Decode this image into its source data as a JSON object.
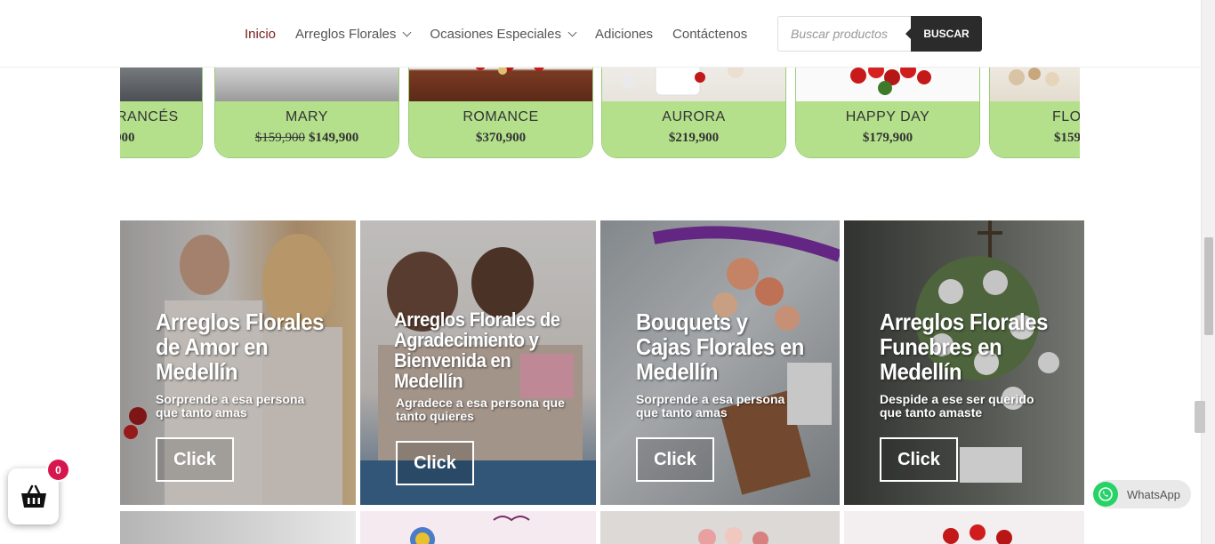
{
  "nav": {
    "items": [
      {
        "label": "Inicio",
        "dropdown": false,
        "active": true
      },
      {
        "label": "Arreglos Florales",
        "dropdown": true
      },
      {
        "label": "Ocasiones Especiales",
        "dropdown": true
      },
      {
        "label": "Adiciones",
        "dropdown": false
      },
      {
        "label": "Contáctenos",
        "dropdown": false
      }
    ],
    "search_placeholder": "Buscar productos",
    "search_button": "BUSCAR"
  },
  "products": [
    {
      "name": "RANCÉS",
      "price": "900"
    },
    {
      "name": "MARY",
      "old_price": "$159,900",
      "price": "$149,900"
    },
    {
      "name": "ROMANCE",
      "price": "$370,900"
    },
    {
      "name": "AURORA",
      "price": "$219,900"
    },
    {
      "name": "HAPPY DAY",
      "price": "$179,900"
    },
    {
      "name": "FLORERO",
      "price": "$159"
    }
  ],
  "categories": [
    {
      "title": "Arreglos Florales de Amor en Medellín",
      "subtitle": "Sorprende a esa persona que tanto amas",
      "button": "Click"
    },
    {
      "title": "Arreglos Florales de Agradecimiento y Bienvenida en Medellín",
      "subtitle": "Agradece a esa persona que tanto quieres",
      "button": "Click"
    },
    {
      "title": "Bouquets y Cajas Florales en Medellín",
      "subtitle": "Sorprende a esa persona que tanto amas",
      "button": "Click"
    },
    {
      "title": "Arreglos Florales Funebres en Medellín",
      "subtitle": "Despide a ese ser querido que tanto amaste",
      "button": "Click"
    }
  ],
  "cart": {
    "count": "0"
  },
  "whatsapp": {
    "label": "WhatsApp"
  },
  "colors": {
    "accent": "#7a2020",
    "product_card": "#b4e08c",
    "cart_badge": "#d6174e",
    "whatsapp": "#25d366"
  }
}
